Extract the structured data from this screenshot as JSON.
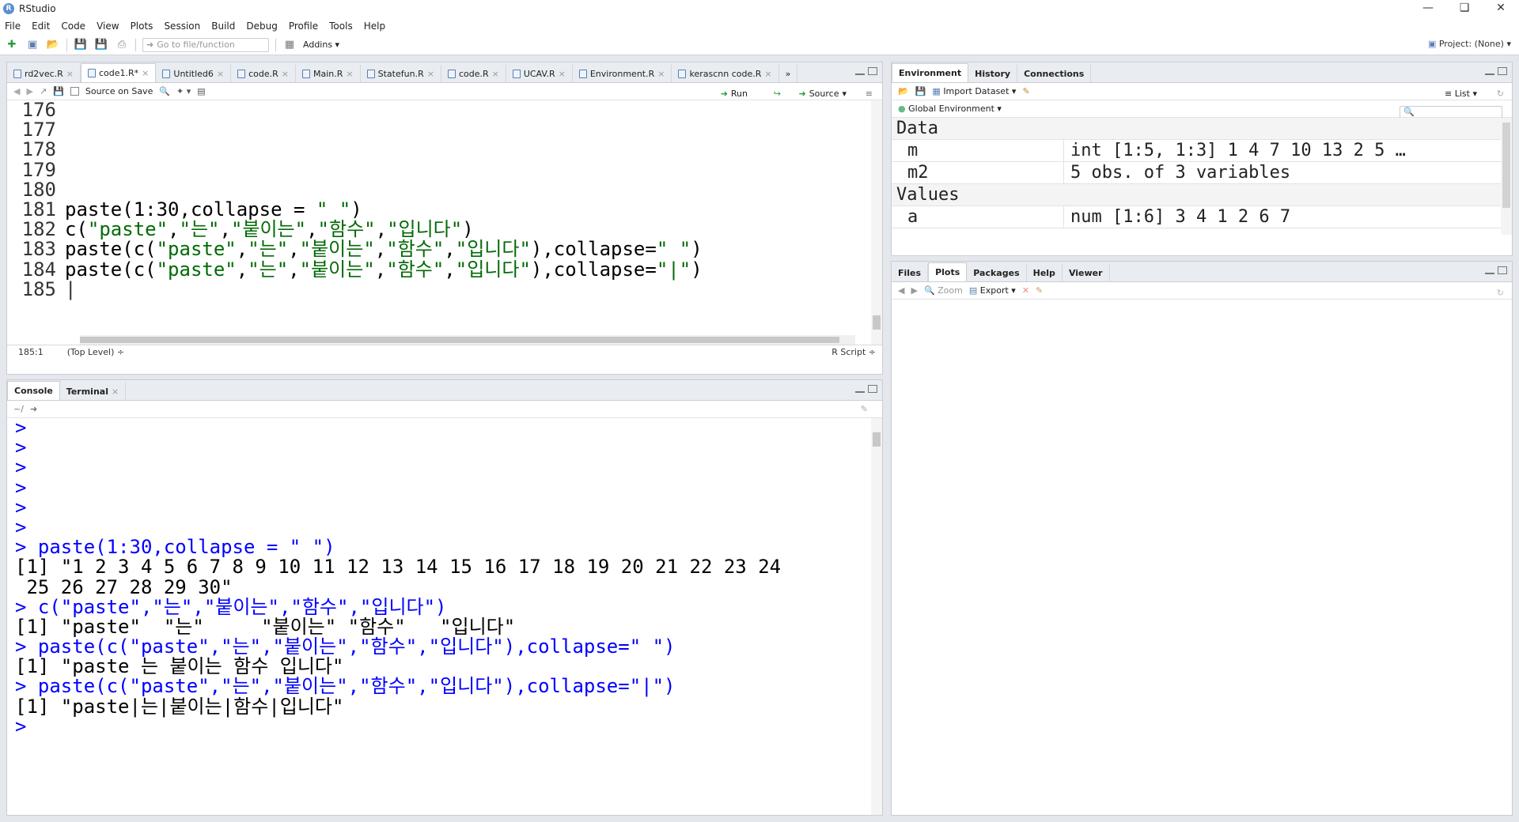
{
  "window": {
    "title": "RStudio",
    "logo": "R"
  },
  "menu": [
    "File",
    "Edit",
    "Code",
    "View",
    "Plots",
    "Session",
    "Build",
    "Debug",
    "Profile",
    "Tools",
    "Help"
  ],
  "toolbar": {
    "goto_placeholder": "Go to file/function",
    "addins": "Addins",
    "project": "Project: (None)"
  },
  "editor": {
    "tabs": [
      {
        "label": "rd2vec.R"
      },
      {
        "label": "code1.R*"
      },
      {
        "label": "Untitled6"
      },
      {
        "label": "code.R"
      },
      {
        "label": "Main.R"
      },
      {
        "label": "Statefun.R"
      },
      {
        "label": "code.R"
      },
      {
        "label": "UCAV.R"
      },
      {
        "label": "Environment.R"
      },
      {
        "label": "kerascnn code.R"
      }
    ],
    "overflow": "»",
    "source_on_save": "Source on Save",
    "run": "Run",
    "source": "Source",
    "line_numbers": [
      "176",
      "177",
      "178",
      "179",
      "180",
      "181",
      "182",
      "183",
      "184",
      "185"
    ],
    "lines": [
      "",
      "",
      "",
      "",
      "",
      "paste(1:30,collapse = \" \")",
      "c(\"paste\",\"는\",\"붙이는\",\"함수\",\"입니다\")",
      "paste(c(\"paste\",\"는\",\"붙이는\",\"함수\",\"입니다\"),collapse=\" \")",
      "paste(c(\"paste\",\"는\",\"붙이는\",\"함수\",\"입니다\"),collapse=\"|\")",
      ""
    ],
    "status": {
      "position": "185:1",
      "scope": "(Top Level) ÷",
      "type": "R Script ÷"
    }
  },
  "console": {
    "tabs": [
      {
        "label": "Console"
      },
      {
        "label": "Terminal"
      }
    ],
    "path": "~/",
    "lines": [
      {
        "kind": "prompt",
        "text": ">"
      },
      {
        "kind": "prompt",
        "text": ">"
      },
      {
        "kind": "prompt",
        "text": ">"
      },
      {
        "kind": "prompt",
        "text": ">"
      },
      {
        "kind": "prompt",
        "text": ">"
      },
      {
        "kind": "prompt",
        "text": ">"
      },
      {
        "kind": "prompt",
        "text": "> paste(1:30,collapse = \" \")"
      },
      {
        "kind": "out",
        "text": "[1] \"1 2 3 4 5 6 7 8 9 10 11 12 13 14 15 16 17 18 19 20 21 22 23 24"
      },
      {
        "kind": "out",
        "text": " 25 26 27 28 29 30\""
      },
      {
        "kind": "prompt",
        "text": "> c(\"paste\",\"는\",\"붙이는\",\"함수\",\"입니다\")"
      },
      {
        "kind": "out",
        "text": "[1] \"paste\"  \"는\"     \"붙이는\" \"함수\"   \"입니다\""
      },
      {
        "kind": "prompt",
        "text": "> paste(c(\"paste\",\"는\",\"붙이는\",\"함수\",\"입니다\"),collapse=\" \")"
      },
      {
        "kind": "out",
        "text": "[1] \"paste 는 붙이는 함수 입니다\""
      },
      {
        "kind": "prompt",
        "text": "> paste(c(\"paste\",\"는\",\"붙이는\",\"함수\",\"입니다\"),collapse=\"|\")"
      },
      {
        "kind": "out",
        "text": "[1] \"paste|는|붙이는|함수|입니다\""
      },
      {
        "kind": "prompt",
        "text": ">"
      }
    ]
  },
  "environment": {
    "tabs": [
      {
        "label": "Environment"
      },
      {
        "label": "History"
      },
      {
        "label": "Connections"
      }
    ],
    "import_dataset": "Import Dataset",
    "list_view": "List",
    "scope": "Global Environment",
    "search_placeholder": "",
    "sections": {
      "data_header": "Data",
      "values_header": "Values"
    },
    "data": [
      {
        "name": "m",
        "value": "int [1:5, 1:3] 1 4 7 10 13 2 5 …"
      },
      {
        "name": "m2",
        "value": "5 obs. of 3 variables"
      }
    ],
    "values": [
      {
        "name": "a",
        "value": "num [1:6] 3 4 1 2 6 7"
      }
    ]
  },
  "files": {
    "tabs": [
      {
        "label": "Files"
      },
      {
        "label": "Plots"
      },
      {
        "label": "Packages"
      },
      {
        "label": "Help"
      },
      {
        "label": "Viewer"
      }
    ],
    "zoom": "Zoom",
    "export": "Export"
  }
}
